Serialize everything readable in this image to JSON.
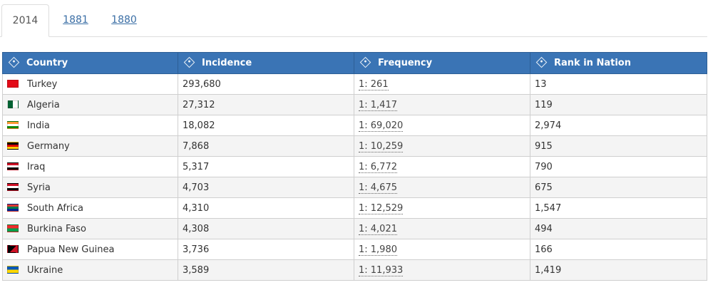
{
  "tabs": [
    {
      "label": "2014",
      "active": true
    },
    {
      "label": "1881",
      "active": false
    },
    {
      "label": "1880",
      "active": false
    }
  ],
  "table": {
    "headers": {
      "country": "Country",
      "incidence": "Incidence",
      "frequency": "Frequency",
      "rank": "Rank in Nation"
    },
    "rows": [
      {
        "country": "Turkey",
        "flag": "turkey-flag-icon",
        "incidence": "293,680",
        "frequency": "1: 261",
        "rank": "13"
      },
      {
        "country": "Algeria",
        "flag": "algeria-flag-icon",
        "incidence": "27,312",
        "frequency": "1: 1,417",
        "rank": "119"
      },
      {
        "country": "India",
        "flag": "india-flag-icon",
        "incidence": "18,082",
        "frequency": "1: 69,020",
        "rank": "2,974"
      },
      {
        "country": "Germany",
        "flag": "germany-flag-icon",
        "incidence": "7,868",
        "frequency": "1: 10,259",
        "rank": "915"
      },
      {
        "country": "Iraq",
        "flag": "iraq-flag-icon",
        "incidence": "5,317",
        "frequency": "1: 6,772",
        "rank": "790"
      },
      {
        "country": "Syria",
        "flag": "syria-flag-icon",
        "incidence": "4,703",
        "frequency": "1: 4,675",
        "rank": "675"
      },
      {
        "country": "South Africa",
        "flag": "south-africa-flag-icon",
        "incidence": "4,310",
        "frequency": "1: 12,529",
        "rank": "1,547"
      },
      {
        "country": "Burkina Faso",
        "flag": "burkina-faso-flag-icon",
        "incidence": "4,308",
        "frequency": "1: 4,021",
        "rank": "494"
      },
      {
        "country": "Papua New Guinea",
        "flag": "papua-new-guinea-flag-icon",
        "incidence": "3,736",
        "frequency": "1: 1,980",
        "rank": "166"
      },
      {
        "country": "Ukraine",
        "flag": "ukraine-flag-icon",
        "incidence": "3,589",
        "frequency": "1: 11,933",
        "rank": "1,419"
      }
    ]
  },
  "colors": {
    "header_bg": "#3a74b5",
    "link": "#3a6ea5",
    "row_alt": "#f4f4f4"
  }
}
